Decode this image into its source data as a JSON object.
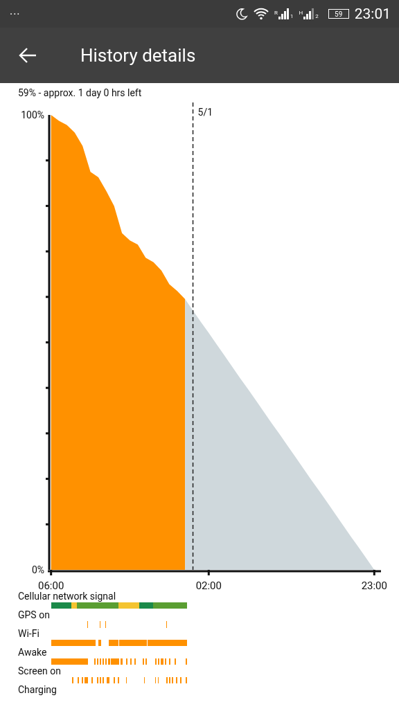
{
  "status_bar": {
    "menu": "···",
    "sims": [
      {
        "network": "R",
        "slot": "1"
      },
      {
        "network": "H",
        "slot": "2"
      }
    ],
    "battery": "59",
    "time": "23:01"
  },
  "app_bar": {
    "title": "History details"
  },
  "summary": "59% - approx. 1 day 0 hrs left",
  "chart_data": {
    "type": "area",
    "categories": [
      "06:00",
      null,
      null,
      null,
      null,
      null,
      null,
      null,
      null,
      null,
      null,
      null,
      null,
      null,
      null,
      null,
      null,
      null,
      null,
      null,
      "02:00",
      null,
      null,
      null,
      null,
      null,
      null,
      null,
      null,
      null,
      null,
      null,
      null,
      null,
      null,
      null,
      null,
      null,
      null,
      null,
      null,
      "23:00"
    ],
    "series": [
      {
        "color": "#ff9100",
        "values": [
          100,
          98.7,
          97.8,
          96.1,
          93.2,
          87.5,
          86.3,
          83.3,
          80,
          74,
          72.4,
          71.5,
          68.6,
          67.6,
          65.8,
          62.8,
          61.3,
          59.5,
          null,
          null,
          null,
          null,
          null,
          null,
          null,
          null,
          null,
          null,
          null,
          null,
          null,
          null,
          null,
          null,
          null,
          null,
          null,
          null,
          null,
          null,
          null,
          null
        ]
      },
      {
        "color": "#cfd8dc",
        "values": [
          null,
          null,
          null,
          null,
          null,
          null,
          null,
          null,
          null,
          null,
          null,
          null,
          null,
          null,
          null,
          null,
          null,
          59.5,
          57,
          54.5,
          52.1,
          49.6,
          47.1,
          44.6,
          42.1,
          39.7,
          37.2,
          34.7,
          32.2,
          29.8,
          27.3,
          24.8,
          22.3,
          19.8,
          17.4,
          14.9,
          12.4,
          9.9,
          7.4,
          5,
          2.5,
          0
        ]
      }
    ],
    "ylim": [
      0,
      100
    ],
    "yticks": [
      {
        "value": 0,
        "label": "0%"
      },
      {
        "value": 100,
        "label": "100%"
      }
    ],
    "annotations": [
      "5/1"
    ]
  },
  "tracks": [
    {
      "label": "Cellular network signal",
      "kind": "signal"
    },
    {
      "label": "GPS on",
      "kind": "sparse"
    },
    {
      "label": "Wi-Fi",
      "kind": "mostly"
    },
    {
      "label": "Awake",
      "kind": "busy"
    },
    {
      "label": "Screen on",
      "kind": "events"
    },
    {
      "label": "Charging",
      "kind": "none"
    }
  ]
}
